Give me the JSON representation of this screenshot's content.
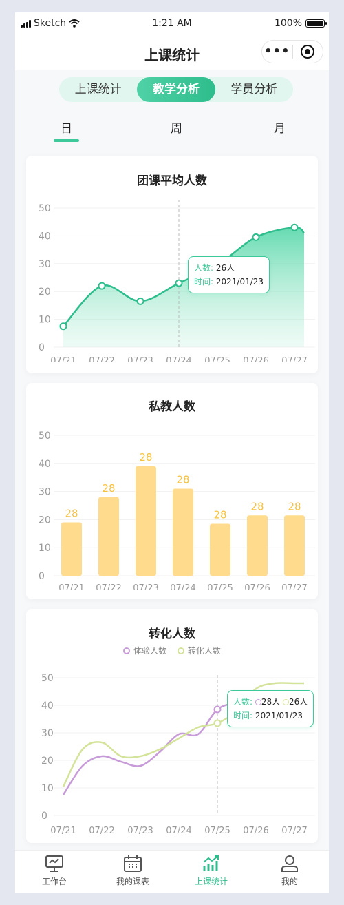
{
  "status": {
    "carrier": "Sketch",
    "time": "1:21 AM",
    "battery": "100%"
  },
  "navbar": {
    "title": "上课统计",
    "more_icon": "more-dots-icon",
    "capsule_icon": "target-icon"
  },
  "segments": [
    "上课统计",
    "教学分析",
    "学员分析"
  ],
  "segment_active": 1,
  "period_tabs": [
    "日",
    "周",
    "月"
  ],
  "period_active": 0,
  "colors": {
    "accent": "#3ec99b",
    "bar": "#ffdb8e",
    "bar_label": "#f5c242",
    "purple": "#c79bd8",
    "yellowgreen": "#d4e39a"
  },
  "chart1": {
    "title": "团课平均人数",
    "tooltip": {
      "count_key": "人数:",
      "count_val": "26人",
      "time_key": "时间:",
      "time_val": "2021/01/23"
    }
  },
  "chart2": {
    "title": "私教人数"
  },
  "chart3": {
    "title": "转化人数",
    "legend": [
      "体验人数",
      "转化人数"
    ],
    "tooltip": {
      "count_key": "人数:",
      "val_a": "28人",
      "val_b": "26人",
      "time_key": "时间:",
      "time_val": "2021/01/23"
    }
  },
  "chart_data": [
    {
      "type": "area",
      "title": "团课平均人数",
      "categories": [
        "07/21",
        "07/22",
        "07/23",
        "07/24",
        "07/25",
        "07/26",
        "07/27"
      ],
      "y_ticks": [
        "0",
        "10",
        "20",
        "30",
        "40",
        "50"
      ],
      "ylim": [
        0,
        50
      ],
      "x": [
        0,
        1,
        2,
        3,
        4,
        5,
        6,
        6.25
      ],
      "values": [
        7.5,
        22,
        16.5,
        23,
        29.5,
        39.5,
        43,
        41
      ],
      "markers": [
        0,
        1,
        2,
        3,
        5,
        6
      ],
      "highlight_index": 3
    },
    {
      "type": "bar",
      "title": "私教人数",
      "categories": [
        "07/21",
        "07/22",
        "07/23",
        "07/24",
        "07/25",
        "07/26",
        "07/27"
      ],
      "y_ticks": [
        "0",
        "10",
        "20",
        "30",
        "40",
        "50"
      ],
      "ylim": [
        0,
        50
      ],
      "values": [
        19,
        28,
        39,
        31,
        18.5,
        21.5,
        21.5
      ],
      "labels": [
        "28",
        "28",
        "28",
        "28",
        "28",
        "28",
        "28"
      ]
    },
    {
      "type": "line",
      "title": "转化人数",
      "categories": [
        "07/21",
        "07/22",
        "07/23",
        "07/24",
        "07/25",
        "07/26",
        "07/27"
      ],
      "y_ticks": [
        "0",
        "10",
        "20",
        "30",
        "40",
        "50"
      ],
      "ylim": [
        0,
        50
      ],
      "series": [
        {
          "name": "体验人数",
          "x": [
            0,
            0.5,
            1,
            1.5,
            2,
            2.5,
            3,
            3.5,
            4,
            4.5,
            5,
            5.5,
            6,
            6.25
          ],
          "values": [
            7.5,
            18,
            21.5,
            19.5,
            18,
            23,
            29.5,
            29.5,
            38.5,
            41,
            43,
            44,
            42,
            40
          ]
        },
        {
          "name": "转化人数",
          "x": [
            0,
            0.5,
            1,
            1.5,
            2,
            2.5,
            3,
            3.5,
            4,
            4.5,
            5,
            5.5,
            6,
            6.25
          ],
          "values": [
            10.5,
            24,
            26.5,
            21.5,
            21.5,
            24,
            28,
            32,
            33.5,
            38,
            46,
            48,
            48,
            48
          ]
        }
      ],
      "highlight_index": 4
    }
  ],
  "tabbar": [
    {
      "label": "工作台",
      "icon": "monitor-icon"
    },
    {
      "label": "我的课表",
      "icon": "calendar-icon"
    },
    {
      "label": "上课统计",
      "icon": "growth-chart-icon"
    },
    {
      "label": "我的",
      "icon": "user-icon"
    }
  ],
  "tab_active": 2
}
